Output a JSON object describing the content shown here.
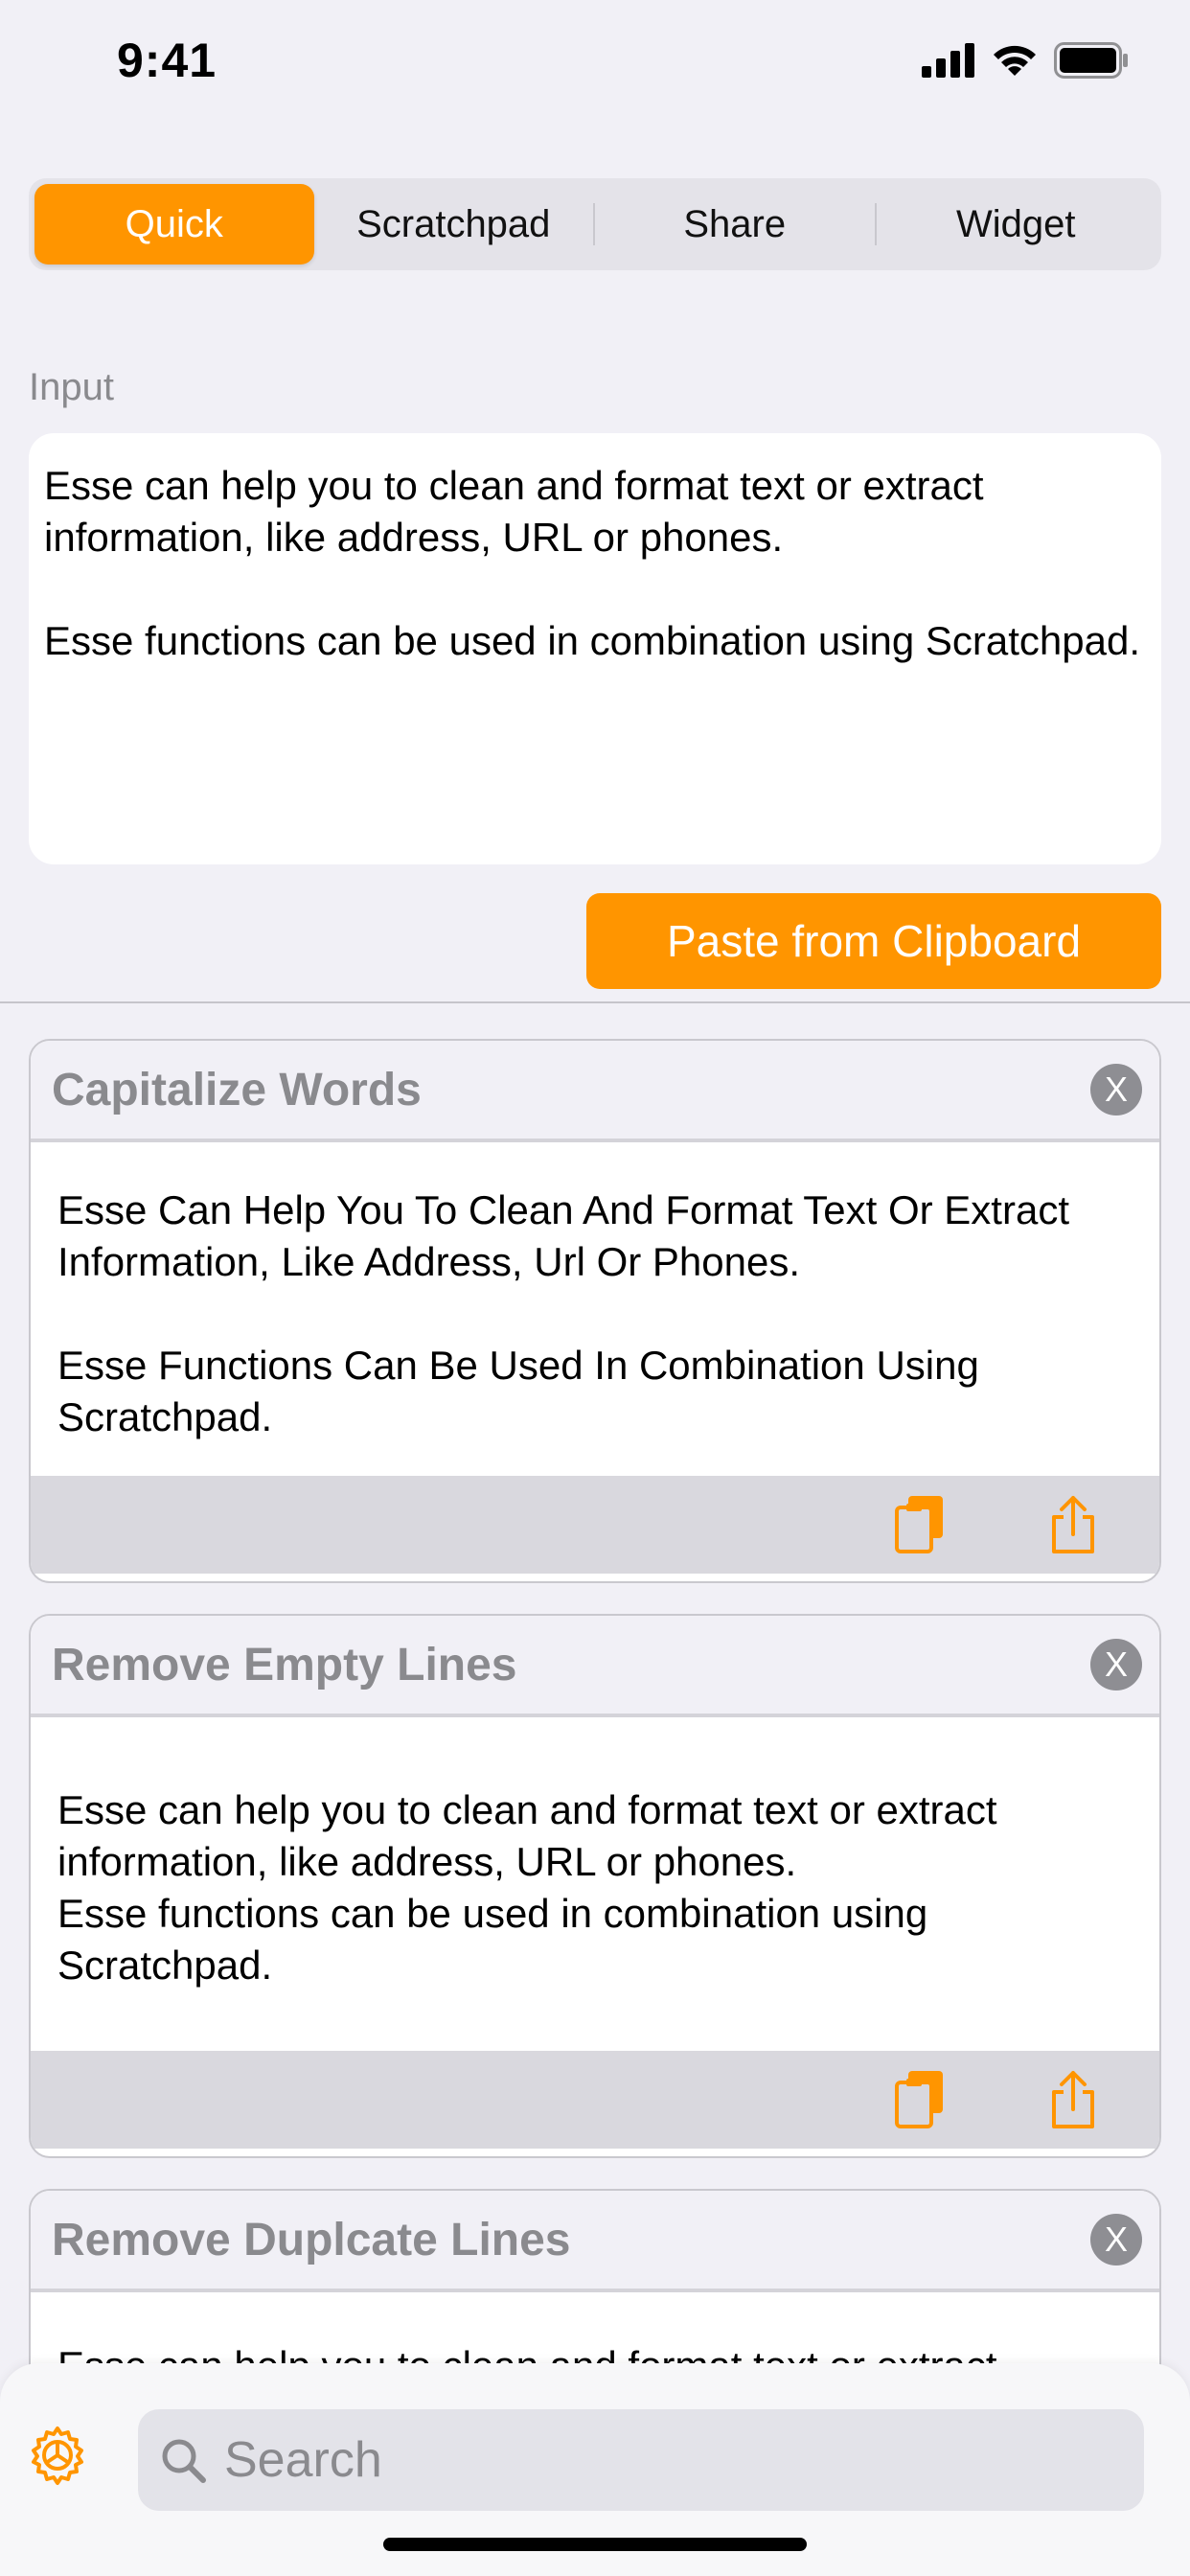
{
  "status_bar": {
    "time": "9:41"
  },
  "tabs": [
    {
      "label": "Quick",
      "active": true
    },
    {
      "label": "Scratchpad",
      "active": false
    },
    {
      "label": "Share",
      "active": false
    },
    {
      "label": "Widget",
      "active": false
    }
  ],
  "input": {
    "label": "Input",
    "paragraph1": "Esse can help you to clean and format text or extract information, like address, URL or phones.",
    "paragraph2": "Esse functions can be used in combination using Scratchpad."
  },
  "paste_button": "Paste from Clipboard",
  "cards": [
    {
      "title": "Capitalize Words",
      "close_label": "X",
      "line1": "Esse Can Help You To Clean And Format Text Or Extract Information, Like Address, Url Or Phones.",
      "line2": "Esse Functions Can Be Used In Combination Using Scratchpad."
    },
    {
      "title": "Remove Empty Lines",
      "close_label": "X",
      "line1": "Esse can help you to clean and format text or extract information, like address, URL or phones.",
      "line2": "Esse functions can be used in combination using Scratchpad."
    },
    {
      "title": "Remove Duplcate Lines",
      "close_label": "X",
      "line1": "Esse can help you to clean and format text or extract"
    }
  ],
  "search": {
    "placeholder": "Search"
  },
  "icons": {
    "copy": "copy-icon",
    "share": "share-icon",
    "settings": "settings-icon",
    "search": "search-icon"
  },
  "colors": {
    "accent": "#ff9500",
    "background": "#f1f0f6"
  }
}
